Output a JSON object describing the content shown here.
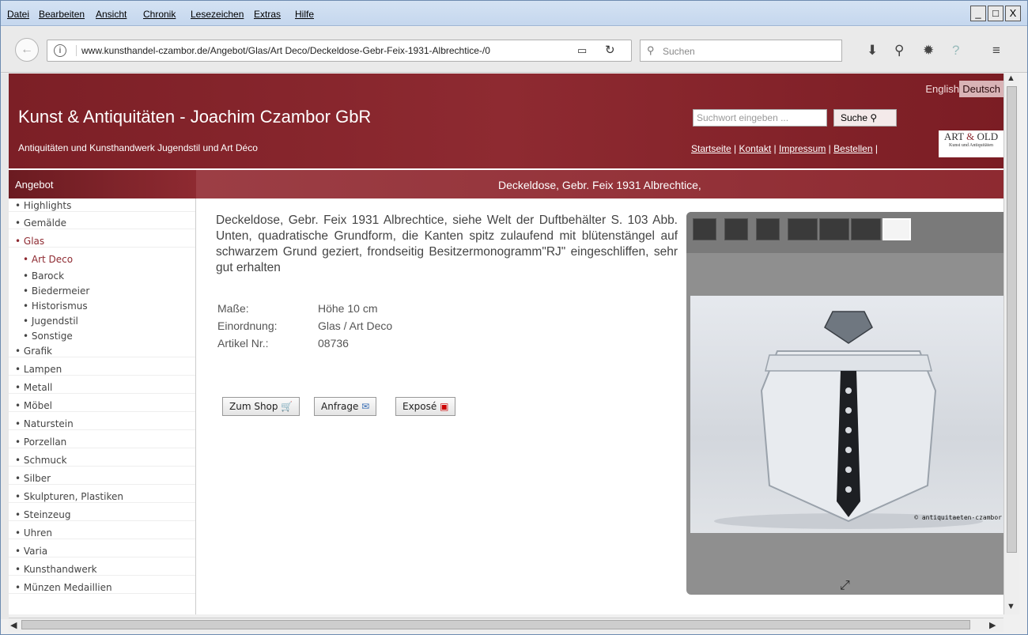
{
  "browser": {
    "menu": [
      "Datei",
      "Bearbeiten",
      "Ansicht",
      "Chronik",
      "Lesezeichen",
      "Extras",
      "Hilfe"
    ],
    "url": "www.kunsthandel-czambor.de/Angebot/Glas/Art Deco/Deckeldose-Gebr-Feix-1931-Albrechtice-/0",
    "search_placeholder": "Suchen",
    "win_min": "_",
    "win_max": "□",
    "win_close": "X"
  },
  "header": {
    "lang_en": "English",
    "lang_de": "Deutsch",
    "title": "Kunst & Antiquitäten - Joachim Czambor GbR",
    "subtitle": "Antiquitäten und Kunsthandwerk Jugendstil und Art Déco",
    "search_placeholder": "Suchwort eingeben ...",
    "search_button": "Suche",
    "nav": [
      "Startseite",
      "Kontakt",
      "Impressum",
      "Bestellen"
    ],
    "logo_line1a": "ART",
    "logo_line1b": " & ",
    "logo_line1c": "OLD",
    "logo_line2": "Kunst und Antiquitäten"
  },
  "sidebar": {
    "heading": "Angebot",
    "items": [
      {
        "label": "• Highlights"
      },
      {
        "label": "• Gemälde"
      },
      {
        "label": "• Glas"
      },
      {
        "label": "• Art Deco"
      },
      {
        "label": "• Barock"
      },
      {
        "label": "• Biedermeier"
      },
      {
        "label": "• Historismus"
      },
      {
        "label": "• Jugendstil"
      },
      {
        "label": "• Sonstige"
      },
      {
        "label": "• Grafik"
      },
      {
        "label": "• Lampen"
      },
      {
        "label": "• Metall"
      },
      {
        "label": "• Möbel"
      },
      {
        "label": "• Naturstein"
      },
      {
        "label": "• Porzellan"
      },
      {
        "label": "• Schmuck"
      },
      {
        "label": "• Silber"
      },
      {
        "label": "• Skulpturen, Plastiken"
      },
      {
        "label": "• Steinzeug"
      },
      {
        "label": "• Uhren"
      },
      {
        "label": "• Varia"
      },
      {
        "label": "• Kunsthandwerk"
      },
      {
        "label": "• Münzen Medaillien"
      }
    ]
  },
  "main": {
    "heading": "Deckeldose, Gebr. Feix 1931 Albrechtice,",
    "description": "Deckeldose, Gebr. Feix 1931 Albrechtice, siehe Welt der Duftbehälter S. 103 Abb. Unten, quadratische Grundform, die Kanten spitz zulaufend mit blütenstängel auf schwarzem Grund geziert, frondseitig Besitzermonogramm\"RJ\" eingeschliffen, sehr gut erhalten",
    "props": [
      {
        "key": "Maße:",
        "value": "Höhe 10 cm"
      },
      {
        "key": "Einordnung:",
        "value": "Glas / Art Deco"
      },
      {
        "key": "Artikel Nr.:",
        "value": "08736"
      }
    ],
    "buttons": {
      "shop": "Zum Shop",
      "inquiry": "Anfrage",
      "expose": "Exposé"
    },
    "watermark": "© antiquitaeten-czambor"
  }
}
